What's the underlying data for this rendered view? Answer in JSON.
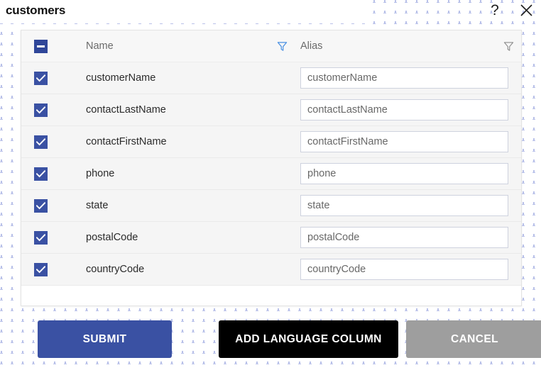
{
  "window": {
    "title": "customers",
    "help_icon": "question-mark-icon",
    "close_icon": "close-x-icon"
  },
  "table": {
    "header": {
      "select_all_state": "indeterminate",
      "columns": [
        {
          "label": "Name",
          "filter_icon": "filter-funnel-icon",
          "filter_active": true
        },
        {
          "label": "Alias",
          "filter_icon": "filter-funnel-icon",
          "filter_active": false
        }
      ]
    },
    "rows": [
      {
        "checked": true,
        "name": "customerName",
        "alias": "customerName"
      },
      {
        "checked": true,
        "name": "contactLastName",
        "alias": "contactLastName"
      },
      {
        "checked": true,
        "name": "contactFirstName",
        "alias": "contactFirstName"
      },
      {
        "checked": true,
        "name": "phone",
        "alias": "phone"
      },
      {
        "checked": true,
        "name": "state",
        "alias": "state"
      },
      {
        "checked": true,
        "name": "postalCode",
        "alias": "postalCode"
      },
      {
        "checked": true,
        "name": "countryCode",
        "alias": "countryCode"
      }
    ]
  },
  "actions": {
    "submit_label": "SUBMIT",
    "add_language_column_label": "ADD LANGUAGE COLUMN",
    "cancel_label": "CANCEL"
  },
  "colors": {
    "accent_blue": "#3a51a3",
    "black_button": "#000000",
    "cancel_gray": "#9e9e9e",
    "filter_active": "#4a90e2",
    "filter_inactive": "#8b8b8b",
    "row_background": "#f5f5f5",
    "header_background": "#f7f7f7",
    "dot_pattern": "#b9c1e9"
  }
}
